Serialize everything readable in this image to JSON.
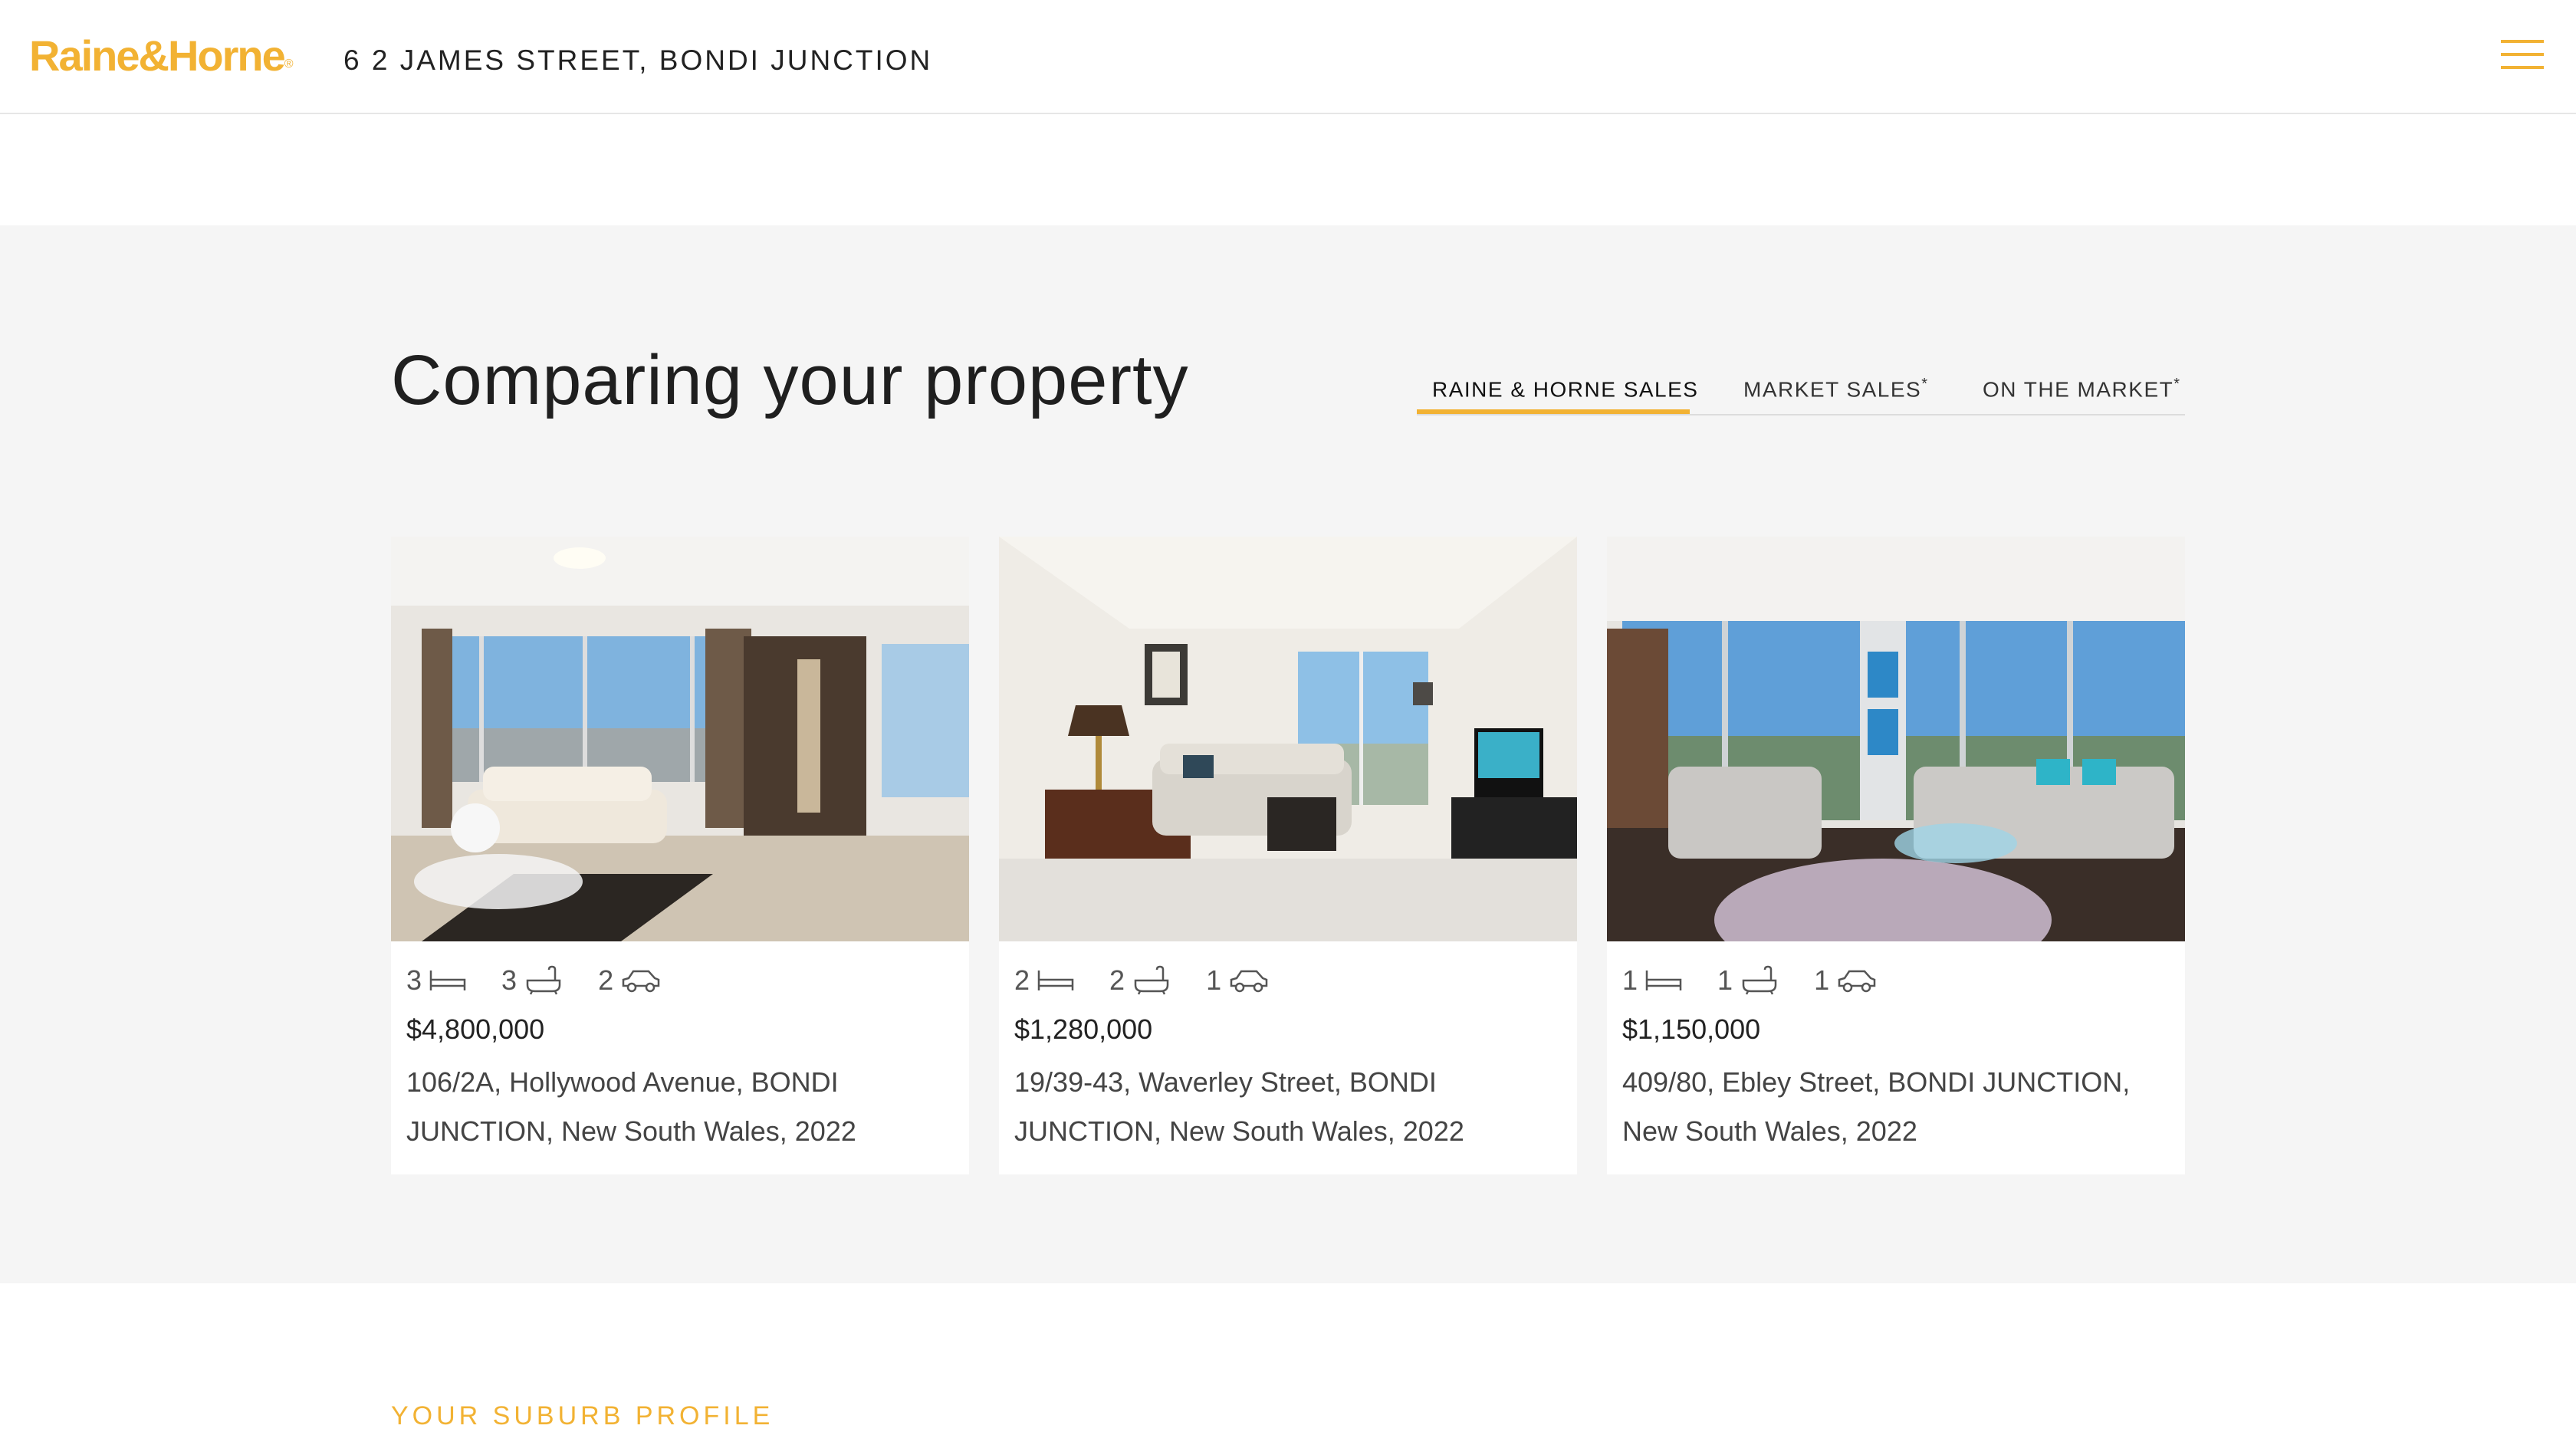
{
  "header": {
    "logo_text": "Raine&Horne",
    "logo_mark": "®",
    "address": "6 2 JAMES STREET, BONDI JUNCTION",
    "menu_icon": "hamburger-menu-icon"
  },
  "compare": {
    "title": "Comparing your property",
    "tabs": [
      {
        "label": "RAINE & HORNE SALES",
        "asterisk": "",
        "active": true
      },
      {
        "label": "MARKET SALES",
        "asterisk": "*",
        "active": false
      },
      {
        "label": "ON THE MARKET",
        "asterisk": "*",
        "active": false
      }
    ],
    "cards": [
      {
        "beds": "3",
        "baths": "3",
        "cars": "2",
        "price": "$4,800,000",
        "address": "106/2A, Hollywood Avenue, BONDI JUNCTION, New South Wales, 2022"
      },
      {
        "beds": "2",
        "baths": "2",
        "cars": "1",
        "price": "$1,280,000",
        "address": "19/39-43, Waverley Street, BONDI JUNCTION, New South Wales, 2022"
      },
      {
        "beds": "1",
        "baths": "1",
        "cars": "1",
        "price": "$1,150,000",
        "address": "409/80, Ebley Street, BONDI JUNCTION, New South Wales, 2022"
      }
    ]
  },
  "suburb_profile": {
    "title": "YOUR SUBURB PROFILE"
  },
  "colors": {
    "brand": "#f2b233",
    "section_bg": "#f5f5f5"
  }
}
